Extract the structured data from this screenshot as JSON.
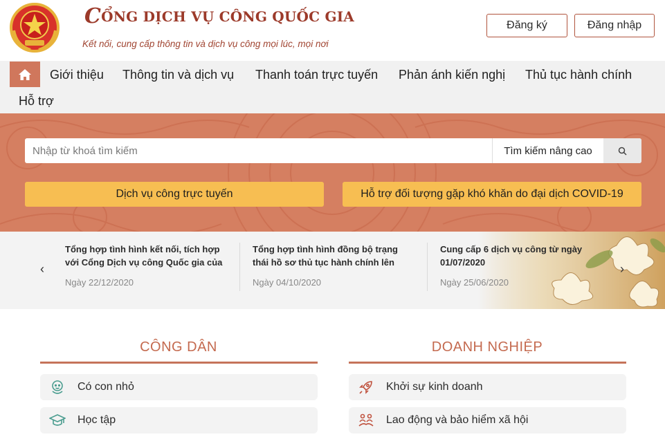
{
  "header": {
    "title_initial": "C",
    "title_rest": "ỔNG DỊCH VỤ CÔNG QUỐC GIA",
    "subtitle": "Kết nối, cung cấp thông tin và dịch vụ công mọi lúc, mọi nơi",
    "register_label": "Đăng ký",
    "login_label": "Đăng nhập"
  },
  "nav": {
    "items": [
      {
        "label": "Giới thiệu"
      },
      {
        "label": "Thông tin và dịch vụ"
      },
      {
        "label": "Thanh toán trực tuyến"
      },
      {
        "label": "Phản ánh kiến nghị"
      },
      {
        "label": "Thủ tục hành chính"
      },
      {
        "label": "Hỗ trợ"
      }
    ]
  },
  "search": {
    "placeholder": "Nhập từ khoá tìm kiếm",
    "advanced_label": "Tìm kiếm nâng cao"
  },
  "quick_buttons": {
    "online_services": "Dịch vụ công trực tuyến",
    "covid_support": "Hỗ trợ đối tượng gặp khó khăn do đại dịch COVID-19"
  },
  "news": [
    {
      "title": "Tổng hợp tình hình kết nối, tích hợp với Cổng Dịch vụ công Quốc gia của Bộ,...",
      "date": "Ngày 22/12/2020"
    },
    {
      "title": "Tổng hợp tình hình đồng bộ trạng thái hồ sơ thủ tục hành chính lên Cổng Dịc...",
      "date": "Ngày 04/10/2020"
    },
    {
      "title": "Cung cấp 6 dịch vụ công từ ngày 01/07/2020",
      "date": "Ngày 25/06/2020"
    }
  ],
  "sections": {
    "citizen": {
      "title": "CÔNG DÂN",
      "items": [
        {
          "label": "Có con nhỏ",
          "icon": "baby-icon"
        },
        {
          "label": "Học tập",
          "icon": "graduation-cap-icon"
        }
      ]
    },
    "business": {
      "title": "DOANH NGHIỆP",
      "items": [
        {
          "label": "Khởi sự kinh doanh",
          "icon": "rocket-icon"
        },
        {
          "label": "Lao động và bảo hiểm xã hội",
          "icon": "workers-icon"
        }
      ]
    }
  },
  "colors": {
    "brand": "#9c3a2a",
    "accent": "#d57f61",
    "yellow": "#f7be52",
    "section_title": "#c46a4f"
  }
}
